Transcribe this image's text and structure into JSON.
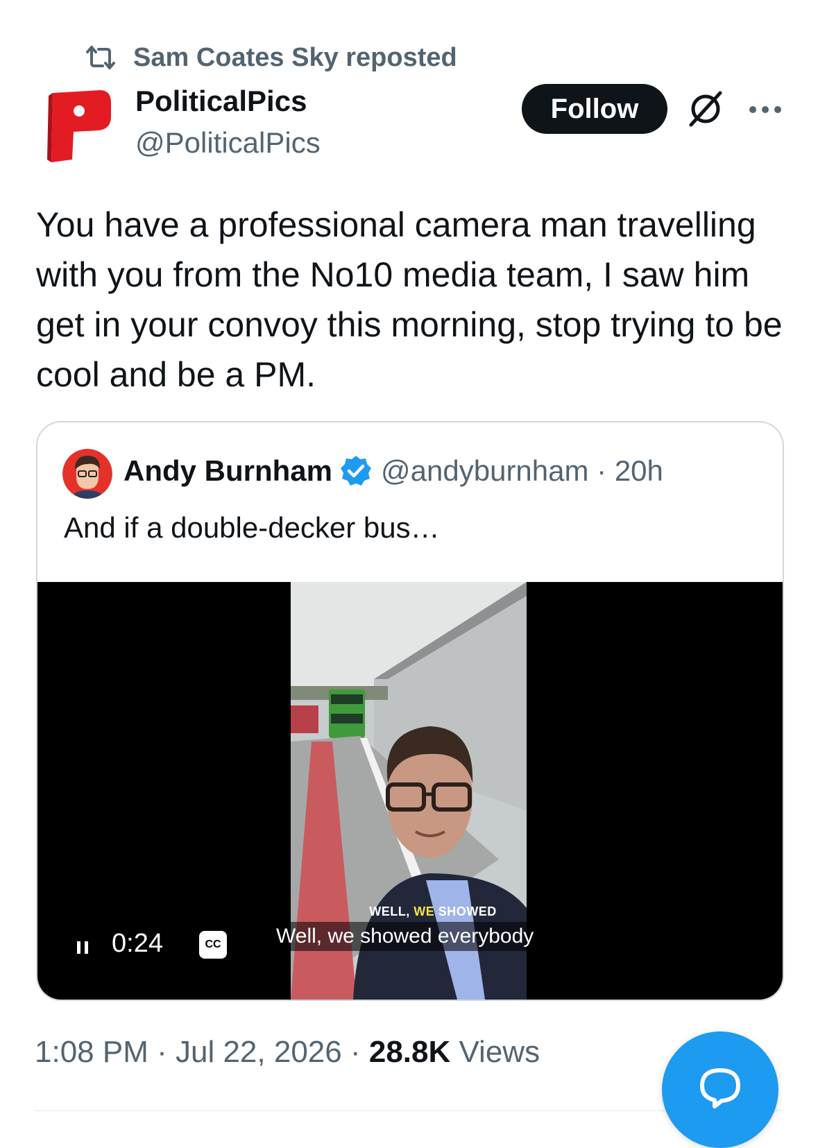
{
  "repost": {
    "text": "Sam Coates Sky reposted",
    "icon": "repost-icon"
  },
  "author": {
    "display_name": "PoliticalPics",
    "handle": "@PoliticalPics",
    "avatar_letter": "P",
    "avatar_color": "#e31b23"
  },
  "actions": {
    "follow_label": "Follow",
    "grok_icon": "grok-icon",
    "more_icon": "more-icon"
  },
  "tweet": {
    "text": "You have a professional camera man travelling with you from the No10 media team, I saw him get in your convoy this morning, stop trying to be cool and be a PM."
  },
  "quote": {
    "name": "Andy Burnham",
    "verified_icon": "verified-badge-icon",
    "meta": "@andyburnham · 20h",
    "text": "And if a double-decker bus…",
    "video": {
      "burned_subtitle_pre": "WELL, ",
      "burned_subtitle_hl": "WE",
      "burned_subtitle_post": " SHOWED",
      "caption": "Well, we showed everybody",
      "time": "0:24",
      "cc_label": "CC",
      "play_state_icon": "pause-icon"
    }
  },
  "footer": {
    "time": "1:08 PM",
    "sep1": " · ",
    "date": "Jul 22, 2026",
    "sep2": " · ",
    "views_count": "28.8K",
    "views_label": " Views"
  },
  "fab": {
    "icon": "reply-bubble-icon"
  },
  "colors": {
    "accent": "#1d9bf0",
    "text": "#0f1419",
    "muted": "#536471",
    "border": "#cfd9de"
  }
}
